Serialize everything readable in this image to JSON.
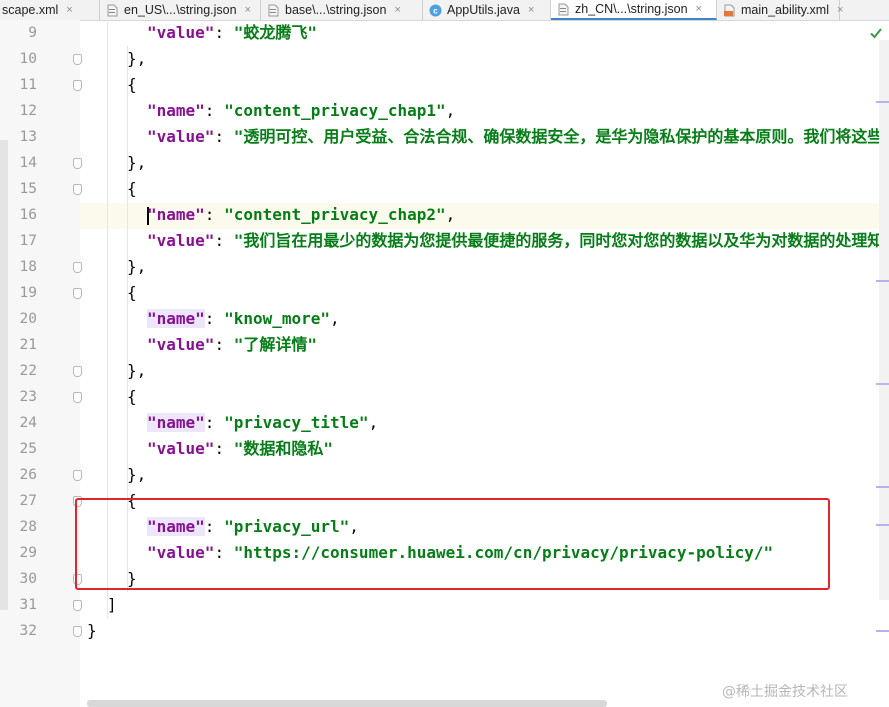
{
  "tabs": [
    {
      "label": "scape.xml",
      "icon": "xml-file-icon",
      "active": false
    },
    {
      "label": "en_US\\...\\string.json",
      "icon": "json-file-icon",
      "active": false
    },
    {
      "label": "base\\...\\string.json",
      "icon": "json-file-icon",
      "active": false
    },
    {
      "label": "AppUtils.java",
      "icon": "java-class-icon",
      "active": false
    },
    {
      "label": "zh_CN\\...\\string.json",
      "icon": "json-file-icon",
      "active": true
    },
    {
      "label": "main_ability.xml",
      "icon": "xml-file-icon",
      "active": false
    }
  ],
  "close_glyph": "×",
  "lines": [
    {
      "n": "9",
      "indent": 3,
      "parts": [
        {
          "t": "key",
          "v": "\"value\""
        },
        {
          "t": "punc",
          "v": ": "
        },
        {
          "t": "str",
          "v": "\"蛟龙腾飞\""
        }
      ]
    },
    {
      "n": "10",
      "indent": 2,
      "parts": [
        {
          "t": "punc",
          "v": "},"
        }
      ]
    },
    {
      "n": "11",
      "indent": 2,
      "parts": [
        {
          "t": "punc",
          "v": "{"
        }
      ]
    },
    {
      "n": "12",
      "indent": 3,
      "parts": [
        {
          "t": "key",
          "v": "\"name\""
        },
        {
          "t": "punc",
          "v": ": "
        },
        {
          "t": "str",
          "v": "\"content_privacy_chap1\""
        },
        {
          "t": "punc",
          "v": ","
        }
      ]
    },
    {
      "n": "13",
      "indent": 3,
      "parts": [
        {
          "t": "key",
          "v": "\"value\""
        },
        {
          "t": "punc",
          "v": ": "
        },
        {
          "t": "str",
          "v": "\"透明可控、用户受益、合法合规、确保数据安全，是华为隐私保护的基本原则。我们将这些原"
        }
      ]
    },
    {
      "n": "14",
      "indent": 2,
      "parts": [
        {
          "t": "punc",
          "v": "},"
        }
      ]
    },
    {
      "n": "15",
      "indent": 2,
      "parts": [
        {
          "t": "punc",
          "v": "{"
        }
      ]
    },
    {
      "n": "16",
      "indent": 3,
      "caret": true,
      "parts": [
        {
          "t": "key",
          "v": "\"name\""
        },
        {
          "t": "punc",
          "v": ": "
        },
        {
          "t": "str",
          "v": "\"content_privacy_chap2\""
        },
        {
          "t": "punc",
          "v": ","
        }
      ]
    },
    {
      "n": "17",
      "indent": 3,
      "parts": [
        {
          "t": "key",
          "v": "\"value\""
        },
        {
          "t": "punc",
          "v": ": "
        },
        {
          "t": "str",
          "v": "\"我们旨在用最少的数据为您提供最便捷的服务，同时您对您的数据以及华为对数据的处理知情"
        }
      ]
    },
    {
      "n": "18",
      "indent": 2,
      "parts": [
        {
          "t": "punc",
          "v": "},"
        }
      ]
    },
    {
      "n": "19",
      "indent": 2,
      "parts": [
        {
          "t": "punc",
          "v": "{"
        }
      ]
    },
    {
      "n": "20",
      "indent": 3,
      "parts": [
        {
          "t": "key-hl",
          "v": "\"name\""
        },
        {
          "t": "punc",
          "v": ": "
        },
        {
          "t": "str",
          "v": "\"know_more\""
        },
        {
          "t": "punc",
          "v": ","
        }
      ]
    },
    {
      "n": "21",
      "indent": 3,
      "parts": [
        {
          "t": "key",
          "v": "\"value\""
        },
        {
          "t": "punc",
          "v": ": "
        },
        {
          "t": "str",
          "v": "\"了解详情\""
        }
      ]
    },
    {
      "n": "22",
      "indent": 2,
      "parts": [
        {
          "t": "punc",
          "v": "},"
        }
      ]
    },
    {
      "n": "23",
      "indent": 2,
      "parts": [
        {
          "t": "punc",
          "v": "{"
        }
      ]
    },
    {
      "n": "24",
      "indent": 3,
      "parts": [
        {
          "t": "key-hl",
          "v": "\"name\""
        },
        {
          "t": "punc",
          "v": ": "
        },
        {
          "t": "str",
          "v": "\"privacy_title\""
        },
        {
          "t": "punc",
          "v": ","
        }
      ]
    },
    {
      "n": "25",
      "indent": 3,
      "parts": [
        {
          "t": "key",
          "v": "\"value\""
        },
        {
          "t": "punc",
          "v": ": "
        },
        {
          "t": "str",
          "v": "\"数据和隐私\""
        }
      ]
    },
    {
      "n": "26",
      "indent": 2,
      "parts": [
        {
          "t": "punc",
          "v": "},"
        }
      ]
    },
    {
      "n": "27",
      "indent": 2,
      "parts": [
        {
          "t": "punc",
          "v": "{"
        }
      ]
    },
    {
      "n": "28",
      "indent": 3,
      "parts": [
        {
          "t": "key-hl",
          "v": "\"name\""
        },
        {
          "t": "punc",
          "v": ": "
        },
        {
          "t": "str",
          "v": "\"privacy_url\""
        },
        {
          "t": "punc",
          "v": ","
        }
      ]
    },
    {
      "n": "29",
      "indent": 3,
      "parts": [
        {
          "t": "key",
          "v": "\"value\""
        },
        {
          "t": "punc",
          "v": ": "
        },
        {
          "t": "str",
          "v": "\"https://consumer.huawei.com/cn/privacy/privacy-policy/\""
        }
      ]
    },
    {
      "n": "30",
      "indent": 2,
      "parts": [
        {
          "t": "punc",
          "v": "}"
        }
      ]
    },
    {
      "n": "31",
      "indent": 1,
      "parts": [
        {
          "t": "punc",
          "v": "]"
        }
      ]
    },
    {
      "n": "32",
      "indent": 0,
      "parts": [
        {
          "t": "punc",
          "v": "}"
        }
      ]
    }
  ],
  "watermark": "@稀土掘金技术社区",
  "colors": {
    "key": "#871094",
    "string": "#067d17",
    "highlight_box": "#e0252b",
    "active_tab_underline": "#4083c9"
  }
}
